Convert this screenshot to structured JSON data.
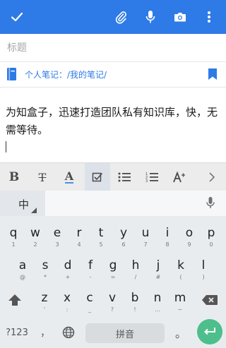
{
  "toolbar": {
    "done_icon": "check-icon",
    "actions": [
      "attachment-icon",
      "mic-icon",
      "camera-icon",
      "more-vertical-icon"
    ],
    "accent_color": "#2e7ae6"
  },
  "note": {
    "title_placeholder": "标题",
    "notebook_path": "个人笔记：/我的笔记/",
    "body": "为知盒子，迅速打造团队私有知识库，快，无需等待。"
  },
  "format_bar": {
    "bold_label": "B",
    "strike_label": "T",
    "color_label": "A",
    "items": [
      "bold-icon",
      "strikethrough-icon",
      "text-color-icon",
      "checkbox-icon",
      "bullet-list-icon",
      "numbered-list-icon",
      "text-size-icon",
      "chevron-right-icon"
    ],
    "active": "checkbox-icon"
  },
  "keyboard": {
    "ime_label": "中",
    "rows": [
      [
        {
          "k": "q",
          "s": "1"
        },
        {
          "k": "w",
          "s": "2"
        },
        {
          "k": "e",
          "s": "3"
        },
        {
          "k": "r",
          "s": "4"
        },
        {
          "k": "t",
          "s": "5"
        },
        {
          "k": "y",
          "s": "6"
        },
        {
          "k": "u",
          "s": "7"
        },
        {
          "k": "i",
          "s": "8"
        },
        {
          "k": "o",
          "s": "9"
        },
        {
          "k": "p",
          "s": "0"
        }
      ],
      [
        {
          "k": "a",
          "s": "@"
        },
        {
          "k": "s",
          "s": "*"
        },
        {
          "k": "d",
          "s": "+"
        },
        {
          "k": "f",
          "s": "-"
        },
        {
          "k": "g",
          "s": "="
        },
        {
          "k": "h",
          "s": "/"
        },
        {
          "k": "j",
          "s": "#"
        },
        {
          "k": "k",
          "s": "("
        },
        {
          "k": "l",
          "s": ")"
        }
      ],
      [
        {
          "k": "z",
          "s": "'"
        },
        {
          "k": "x",
          "s": ":"
        },
        {
          "k": "c",
          "s": "_"
        },
        {
          "k": "v",
          "s": "?"
        },
        {
          "k": "b",
          "s": "!"
        },
        {
          "k": "n",
          "s": "…"
        },
        {
          "k": "m",
          "s": "~"
        }
      ]
    ],
    "symbols_label": "?123",
    "comma_label": "，",
    "space_label": "拼音",
    "period_label": "。",
    "enter_color": "#4cbf8c"
  }
}
